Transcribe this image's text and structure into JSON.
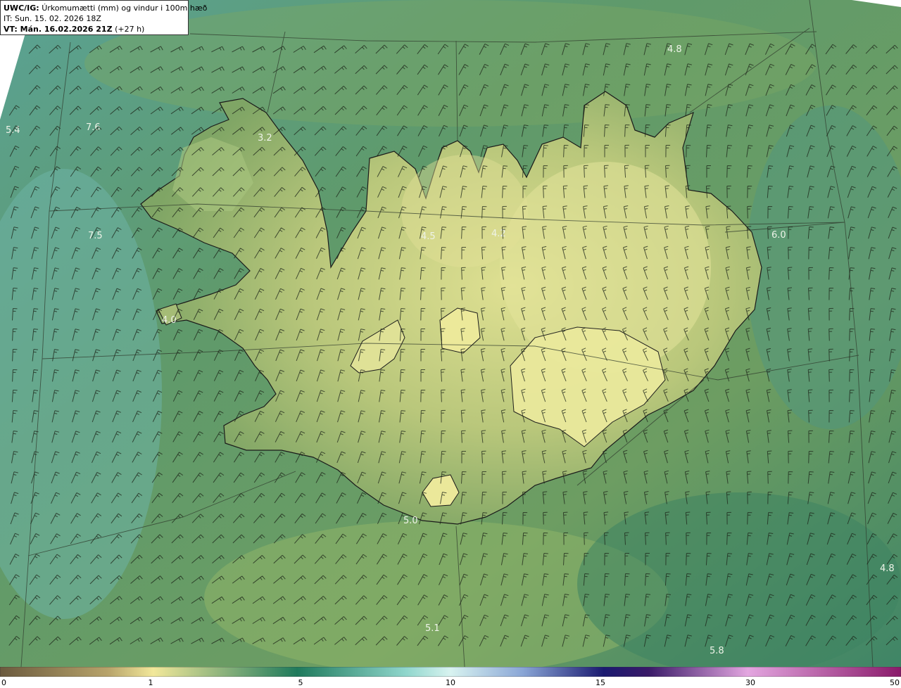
{
  "header": {
    "model": "UWC/IG:",
    "title": "Úrkomumætti (mm) og vindur i 100m hæð",
    "issue_time": "IT: Sun. 15. 02. 2026 18Z",
    "valid_prefix": "VT: Mán. 16.02.2026 21Z",
    "valid_suffix": "(+27 h)"
  },
  "map_labels": [
    "4.8",
    "7.6",
    "5.4",
    "3.2",
    "4.5",
    "4.2",
    "6.0",
    "7.5",
    "4.0",
    "5.0",
    "4.8",
    "5.1",
    "5.8"
  ],
  "colorbar": {
    "tick_labels": [
      "0",
      "1",
      "5",
      "10",
      "15",
      "30",
      "50"
    ],
    "colors": [
      "#6b5a3e",
      "#c7b46a",
      "#f2e89a",
      "#1f7a5c",
      "#8fd6cc",
      "#c4eef0",
      "#2c2a8a",
      "#1a1450",
      "#e89adf",
      "#8a1a6a"
    ]
  },
  "colors": {
    "land_high": "#d9dd8c",
    "land_mid": "#93b56a",
    "sea_green": "#5c9666",
    "sea_teal": "#5fa79a",
    "coast": "#1a1a1a"
  }
}
